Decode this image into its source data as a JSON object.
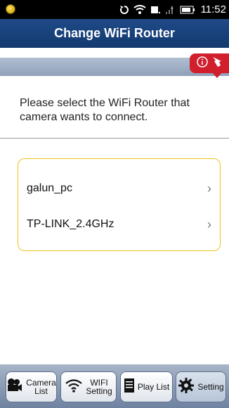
{
  "status_bar": {
    "time": "11:52"
  },
  "header": {
    "title": "Change WiFi Router"
  },
  "instruction": "Please select the WiFi Router that camera wants to connect.",
  "routers": [
    {
      "name": "galun_pc"
    },
    {
      "name": "TP-LINK_2.4GHz"
    }
  ],
  "tabs": [
    {
      "label_line1": "Camera",
      "label_line2": "List",
      "icon": "camera-icon"
    },
    {
      "label_line1": "WIFI",
      "label_line2": "Setting",
      "icon": "wifi-icon"
    },
    {
      "label_line1": "Play List",
      "label_line2": "",
      "icon": "document-icon"
    },
    {
      "label_line1": "Setting",
      "label_line2": "",
      "icon": "gear-icon"
    }
  ],
  "colors": {
    "header": "#1f4a87",
    "accent_red": "#d11f2e",
    "list_border": "#f0c21a"
  }
}
